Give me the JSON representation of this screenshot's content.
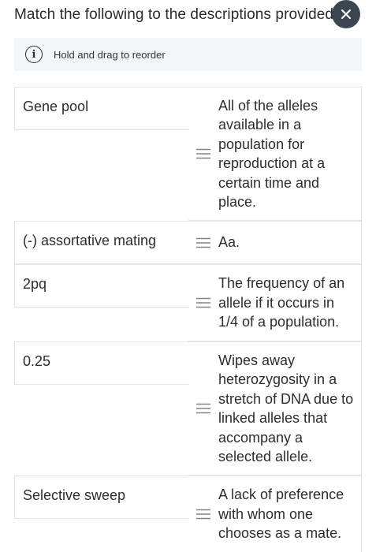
{
  "header": {
    "title": "Match the following to the descriptions provided.",
    "close_icon": "close-icon"
  },
  "info": {
    "icon": "info-icon",
    "glyph": "i",
    "text": "Hold and drag to reorder"
  },
  "rows": [
    {
      "term": "Gene pool",
      "description": "All of the alleles available in a population for reproduction at a certain time and place."
    },
    {
      "term": "(-) assortative mating",
      "description": "Aa."
    },
    {
      "term": "2pq",
      "description": "The frequency of an allele if it occurs in 1/4 of a population."
    },
    {
      "term": "0.25",
      "description": "Wipes away heterozygosity in a stretch of DNA due to linked alleles that accompany a selected allele."
    },
    {
      "term": "Selective sweep",
      "description": "A lack of preference with whom one chooses as a mate."
    }
  ],
  "colors": {
    "close_button_bg": "#3b4650",
    "info_bar_bg": "#f1f6fb",
    "border": "#e3e6e9",
    "text": "#2d2d2d"
  }
}
